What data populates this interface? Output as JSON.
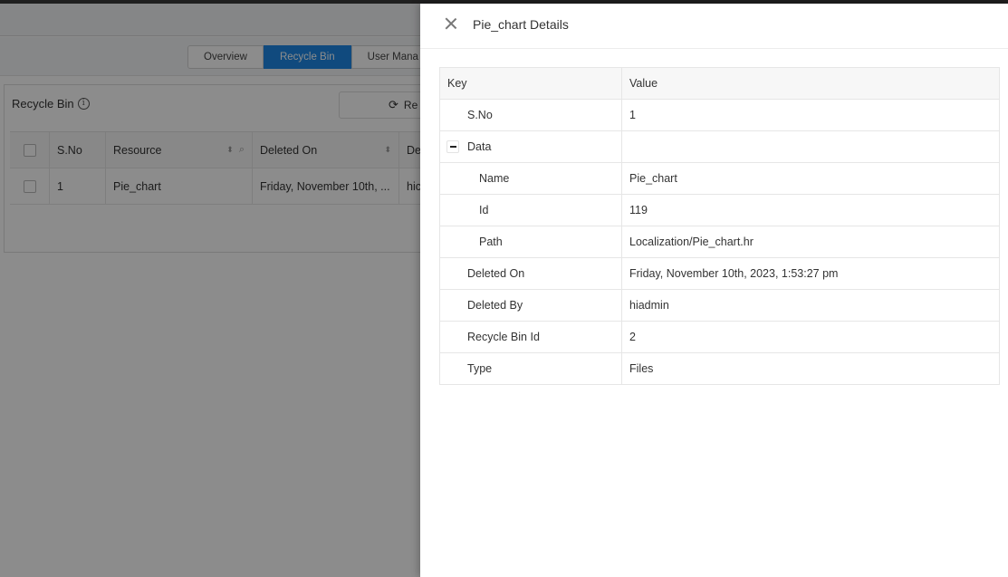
{
  "tabs": [
    {
      "label": "Overview"
    },
    {
      "label": "Recycle Bin",
      "active": true
    },
    {
      "label": "User Mana"
    }
  ],
  "card": {
    "title": "Recycle Bin",
    "refresh_label": "Re"
  },
  "grid": {
    "columns": [
      "S.No",
      "Resource",
      "Deleted On",
      "De"
    ],
    "rows": [
      {
        "sno": "1",
        "resource": "Pie_chart",
        "deleted_on": "Friday, November 10th, ...",
        "deleted_by": "hic"
      }
    ]
  },
  "drawer": {
    "title": "Pie_chart Details",
    "columns": {
      "key": "Key",
      "value": "Value"
    },
    "rows": [
      {
        "key": "S.No",
        "value": "1"
      },
      {
        "key": "Data",
        "value": ""
      },
      {
        "key": "Name",
        "value": "Pie_chart"
      },
      {
        "key": "Id",
        "value": "119"
      },
      {
        "key": "Path",
        "value": "Localization/Pie_chart.hr"
      },
      {
        "key": "Deleted On",
        "value": "Friday, November 10th, 2023, 1:53:27 pm"
      },
      {
        "key": "Deleted By",
        "value": "hiadmin"
      },
      {
        "key": "Recycle Bin Id",
        "value": "2"
      },
      {
        "key": "Type",
        "value": "Files"
      }
    ]
  },
  "colors": {
    "accent": "#1e88e5",
    "overlay": "rgba(0,0,0,0.45)"
  }
}
